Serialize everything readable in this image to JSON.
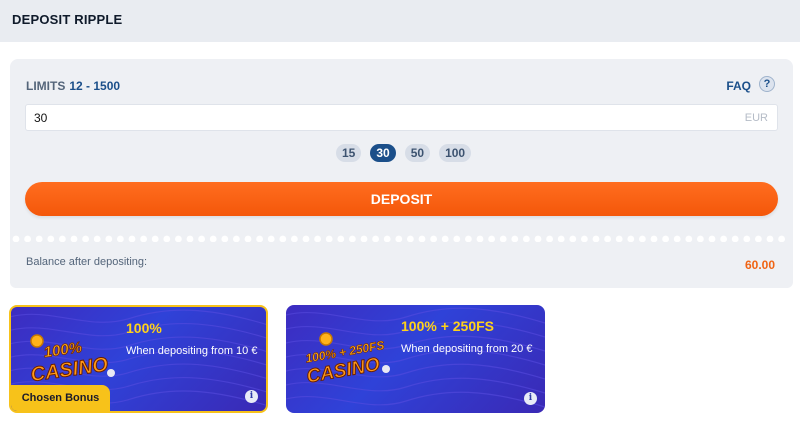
{
  "header": {
    "title": "DEPOSIT RIPPLE"
  },
  "limits": {
    "label": "LIMITS",
    "range": "12 - 1500"
  },
  "faq": {
    "label": "FAQ",
    "help_glyph": "?"
  },
  "amount": {
    "value": "30",
    "currency": "EUR"
  },
  "chips": [
    "15",
    "30",
    "50",
    "100"
  ],
  "selected_chip": "30",
  "deposit_button": {
    "label": "DEPOSIT"
  },
  "balance": {
    "label": "Balance after depositing:",
    "value": "60.00"
  },
  "bonuses": [
    {
      "art_text": "100% CASINO",
      "title": "100%",
      "description": "When depositing from 10 €",
      "chosen": true,
      "chosen_label": "Chosen Bonus"
    },
    {
      "art_text": "100% + 250FS CASINO",
      "title": "100% + 250FS",
      "description": "When depositing from 20 €",
      "chosen": false
    }
  ],
  "colors": {
    "accent_orange": "#f4570a",
    "link_blue": "#1b4f8a",
    "bonus_yellow": "#ffd21a",
    "card_purple": "#3d2cc0"
  },
  "icons": {
    "help": "question-icon",
    "info": "info-icon"
  }
}
